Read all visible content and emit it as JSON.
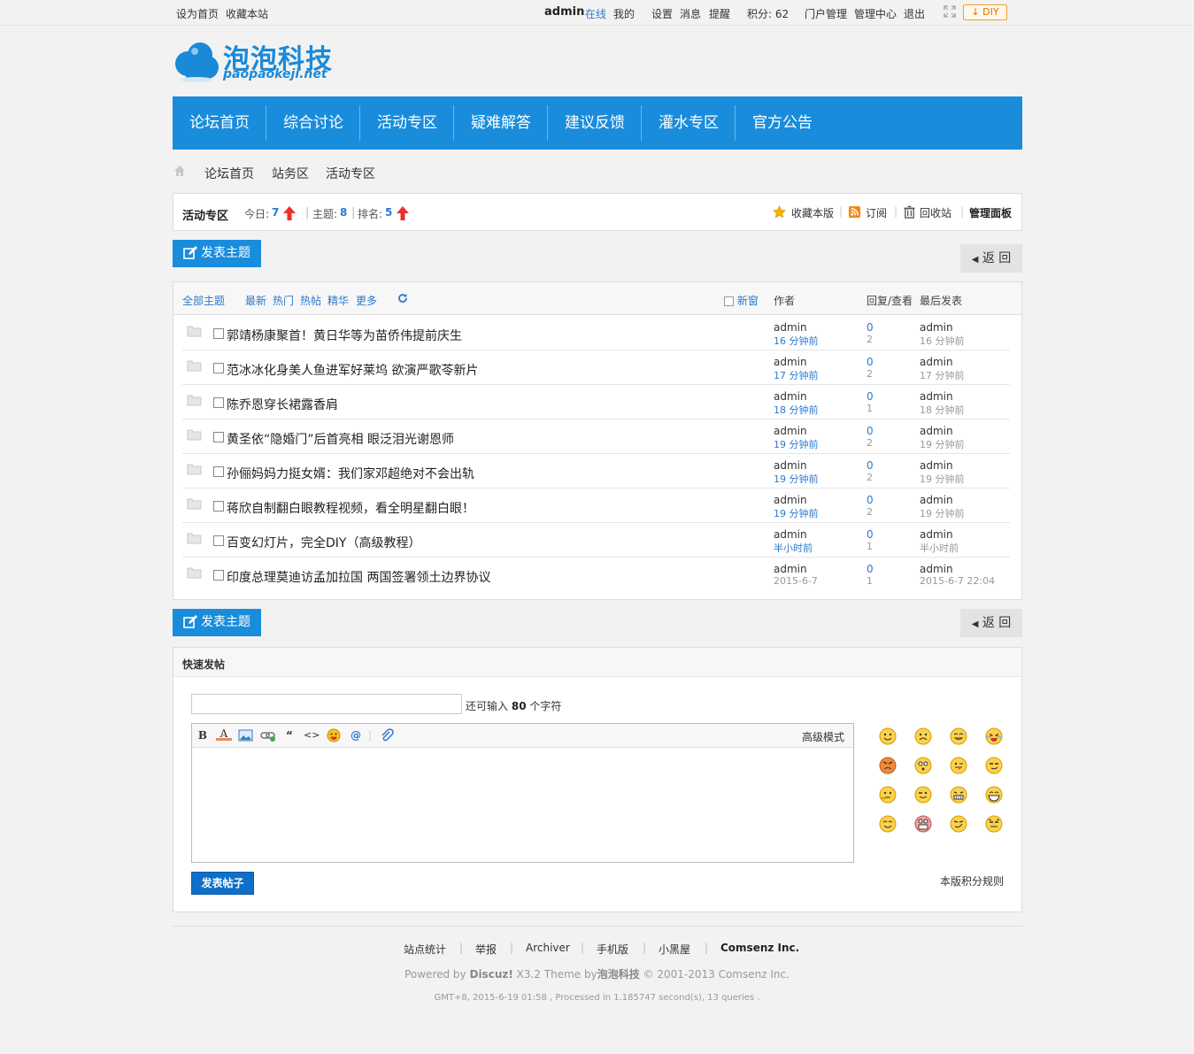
{
  "topbar": {
    "set_home": "设为首页",
    "bookmark": "收藏本站",
    "username": "admin",
    "online": "在线",
    "mine": "我的",
    "settings": "设置",
    "messages": "消息",
    "reminders": "提醒",
    "points": "积分: 62",
    "portal_admin": "门户管理",
    "admin_center": "管理中心",
    "logout": "退出",
    "diy": "DIY"
  },
  "logo": {
    "title": "泡泡科技",
    "subtitle": "paopaokeji.net"
  },
  "nav": {
    "items": [
      {
        "label": "论坛首页"
      },
      {
        "label": "综合讨论"
      },
      {
        "label": "活动专区"
      },
      {
        "label": "疑难解答"
      },
      {
        "label": "建议反馈"
      },
      {
        "label": "灌水专区"
      },
      {
        "label": "官方公告"
      }
    ]
  },
  "breadcrumb": {
    "items": [
      "论坛首页",
      "站务区",
      "活动专区"
    ]
  },
  "forum": {
    "name": "活动专区",
    "today_label": "今日:",
    "today": "7",
    "topics_label": "主题:",
    "topics": "8",
    "rank_label": "排名:",
    "rank": "5",
    "favorite": "收藏本版",
    "subscribe": "订阅",
    "recycle": "回收站",
    "admin_panel": "管理面板",
    "accent": "#1a8cdc"
  },
  "actions": {
    "new_thread": "发表主题",
    "back": "返 回"
  },
  "thread_list": {
    "filters": {
      "all": "全部主题",
      "latest": "最新",
      "hot": "热门",
      "hot_posts": "热帖",
      "digest": "精华",
      "more": "更多"
    },
    "new_window": "新窗",
    "col_author": "作者",
    "col_replies": "回复/查看",
    "col_last": "最后发表",
    "rows": [
      {
        "title": "郭靖杨康聚首！黄日华等为苗侨伟提前庆生",
        "author": "admin",
        "time": "16 分钟前",
        "replies": "0",
        "views": "2",
        "last_user": "admin",
        "last_time": "16 分钟前"
      },
      {
        "title": "范冰冰化身美人鱼进军好莱坞 欲演严歌苓新片",
        "author": "admin",
        "time": "17 分钟前",
        "replies": "0",
        "views": "2",
        "last_user": "admin",
        "last_time": "17 分钟前"
      },
      {
        "title": "陈乔恩穿长裙露香肩",
        "author": "admin",
        "time": "18 分钟前",
        "replies": "0",
        "views": "1",
        "last_user": "admin",
        "last_time": "18 分钟前"
      },
      {
        "title": "黄圣依“隐婚门”后首亮相 眼泛泪光谢恩师",
        "author": "admin",
        "time": "19 分钟前",
        "replies": "0",
        "views": "2",
        "last_user": "admin",
        "last_time": "19 分钟前"
      },
      {
        "title": "孙俪妈妈力挺女婿：我们家邓超绝对不会出轨",
        "author": "admin",
        "time": "19 分钟前",
        "replies": "0",
        "views": "2",
        "last_user": "admin",
        "last_time": "19 分钟前"
      },
      {
        "title": "蒋欣自制翻白眼教程视频，看全明星翻白眼！",
        "author": "admin",
        "time": "19 分钟前",
        "replies": "0",
        "views": "2",
        "last_user": "admin",
        "last_time": "19 分钟前"
      },
      {
        "title": "百变幻灯片，完全DIY（高级教程）",
        "author": "admin",
        "time": "半小时前",
        "replies": "0",
        "views": "1",
        "last_user": "admin",
        "last_time": "半小时前"
      },
      {
        "title": "印度总理莫迪访孟加拉国 两国签署领土边界协议",
        "author": "admin",
        "time": "2015-6-7",
        "replies": "0",
        "views": "1",
        "last_user": "admin",
        "last_time": "2015-6-7 22:04"
      }
    ]
  },
  "quick_post": {
    "title": "快速发帖",
    "subject_value": "",
    "hint_prefix": "还可输入",
    "hint_count": "80",
    "hint_suffix": "个字符",
    "advanced": "高级模式",
    "submit": "发表帖子",
    "rules": "本版积分规则",
    "toolbar": {
      "bold": "B",
      "color": "A",
      "quote": "“",
      "code": "<>",
      "at": "@"
    }
  },
  "footer": {
    "links": [
      "站点统计",
      "举报",
      "Archiver",
      "手机版",
      "小黑屋",
      "Comsenz Inc."
    ],
    "powered_prefix": "Powered by",
    "powered_brand": "Discuz!",
    "powered_rest": "X3.2 Theme by",
    "powered_theme": "泡泡科技",
    "powered_copy": "© 2001-2013 Comsenz Inc.",
    "gmt": "GMT+8, 2015-6-19 01:58 , Processed in 1.185747 second(s), 13 queries ."
  }
}
